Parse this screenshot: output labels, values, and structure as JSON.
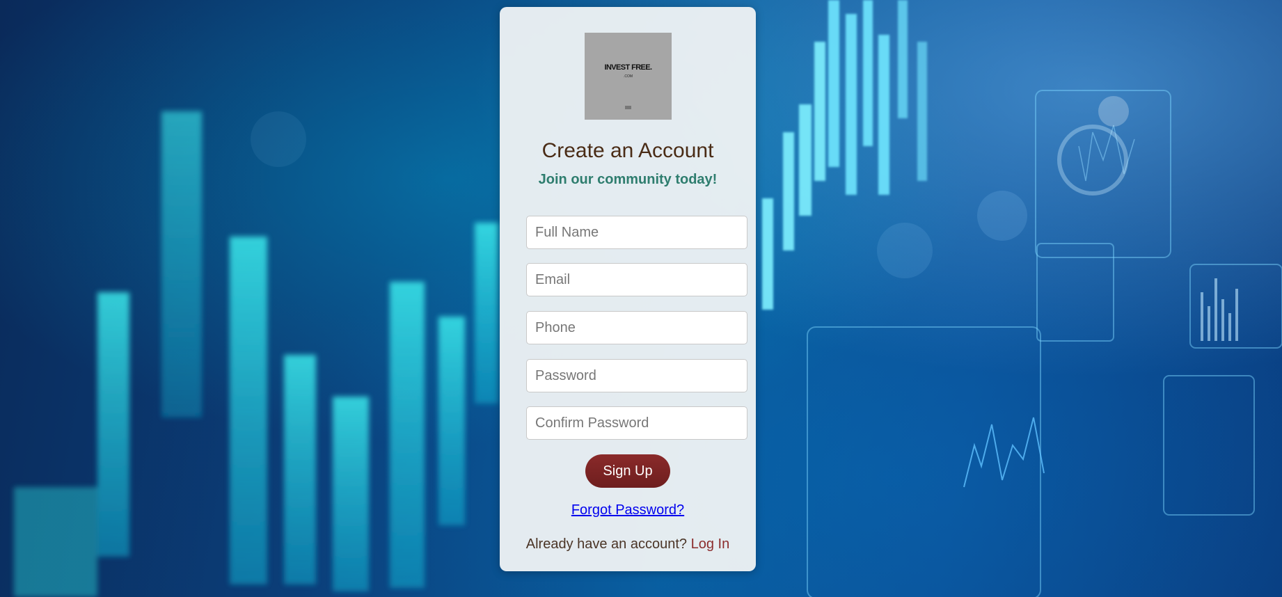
{
  "logo": {
    "text": "INVEST FREE.",
    "subtext": ".COM"
  },
  "header": {
    "title": "Create an Account",
    "subtitle": "Join our community today!"
  },
  "form": {
    "full_name_placeholder": "Full Name",
    "email_placeholder": "Email",
    "phone_placeholder": "Phone",
    "password_placeholder": "Password",
    "confirm_password_placeholder": "Confirm Password",
    "submit_label": "Sign Up"
  },
  "links": {
    "forgot_password": "Forgot Password?",
    "already_account": "Already have an account?",
    "login": "Log In"
  },
  "colors": {
    "title": "#4a2c16",
    "subtitle": "#2e7d6e",
    "button": "#7a2424",
    "login_link": "#8b2c2c"
  }
}
